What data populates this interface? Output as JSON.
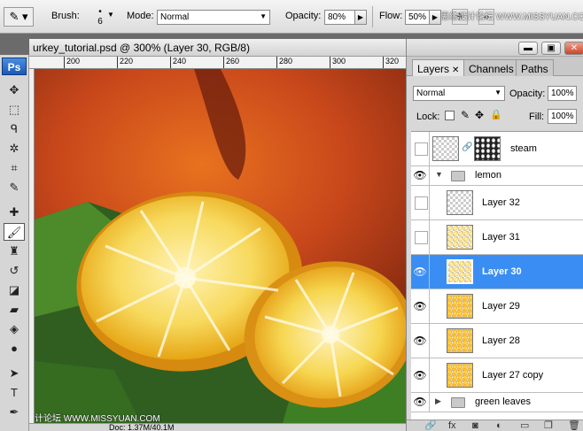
{
  "options_bar": {
    "brush_label": "Brush:",
    "brush_size": "6",
    "mode_label": "Mode:",
    "mode_value": "Normal",
    "opacity_label": "Opacity:",
    "opacity_value": "80%",
    "flow_label": "Flow:",
    "flow_value": "50%"
  },
  "watermarks": {
    "top": "思缘设计论坛 WWW.MISSYUAN.COM",
    "bottom": "思缘设计论坛 WWW.MISSYUAN.COM"
  },
  "toolbar": {
    "logo": "Ps",
    "tools": [
      {
        "name": "move-tool",
        "glyph": "✥"
      },
      {
        "name": "marquee-tool",
        "glyph": "⬚"
      },
      {
        "name": "lasso-tool",
        "glyph": "ᑫ"
      },
      {
        "name": "magic-wand-tool",
        "glyph": "✲"
      },
      {
        "name": "crop-tool",
        "glyph": "⌗"
      },
      {
        "name": "slice-tool",
        "glyph": "✎"
      },
      {
        "name": "healing-brush-tool",
        "glyph": "✚"
      },
      {
        "name": "brush-tool",
        "glyph": "🖌"
      },
      {
        "name": "clone-stamp-tool",
        "glyph": "♜"
      },
      {
        "name": "history-brush-tool",
        "glyph": "↺"
      },
      {
        "name": "eraser-tool",
        "glyph": "◪"
      },
      {
        "name": "gradient-tool",
        "glyph": "▰"
      },
      {
        "name": "blur-tool",
        "glyph": "◈"
      },
      {
        "name": "dodge-tool",
        "glyph": "●"
      },
      {
        "name": "path-selection-tool",
        "glyph": "➤"
      },
      {
        "name": "type-tool",
        "glyph": "T"
      },
      {
        "name": "pen-tool",
        "glyph": "✒"
      }
    ]
  },
  "document": {
    "title": "urkey_tutorial.psd @ 300% (Layer 30, RGB/8)",
    "ruler_ticks": [
      "200",
      "220",
      "240",
      "260",
      "280",
      "300",
      "320"
    ],
    "status": "Doc: 1.37M/40.1M"
  },
  "panel": {
    "tabs": [
      {
        "label": "Layers",
        "active": true
      },
      {
        "label": "Channels",
        "active": false
      },
      {
        "label": "Paths",
        "active": false
      }
    ],
    "blend_mode": "Normal",
    "opacity_label": "Opacity:",
    "opacity_value": "100%",
    "lock_label": "Lock:",
    "fill_label": "Fill:",
    "fill_value": "100%",
    "layers": [
      {
        "name": "steam",
        "type": "layer",
        "visible": false,
        "mask": true,
        "thumb": "checker"
      },
      {
        "name": "lemon",
        "type": "group",
        "visible": true,
        "expanded": true
      },
      {
        "name": "Layer 32",
        "type": "layer",
        "visible": false,
        "thumb": "checker"
      },
      {
        "name": "Layer 31",
        "type": "layer",
        "visible": false,
        "thumb": "lemon-light"
      },
      {
        "name": "Layer 30",
        "type": "layer",
        "visible": true,
        "selected": true,
        "thumb": "lemon-light"
      },
      {
        "name": "Layer 29",
        "type": "layer",
        "visible": true,
        "thumb": "lemon"
      },
      {
        "name": "Layer 28",
        "type": "layer",
        "visible": true,
        "thumb": "lemon"
      },
      {
        "name": "Layer 27 copy",
        "type": "layer",
        "visible": true,
        "thumb": "lemon"
      },
      {
        "name": "green leaves",
        "type": "group",
        "visible": true,
        "expanded": false
      }
    ],
    "footer_icons": [
      "link-icon",
      "fx-icon",
      "mask-icon",
      "adjustment-icon",
      "new-group-icon",
      "new-layer-icon",
      "trash-icon"
    ]
  },
  "colors": {
    "selection": "#3a8ef3",
    "lemon": "#f5c630",
    "orange": "#d9571a",
    "leaves": "#3c6b22"
  }
}
